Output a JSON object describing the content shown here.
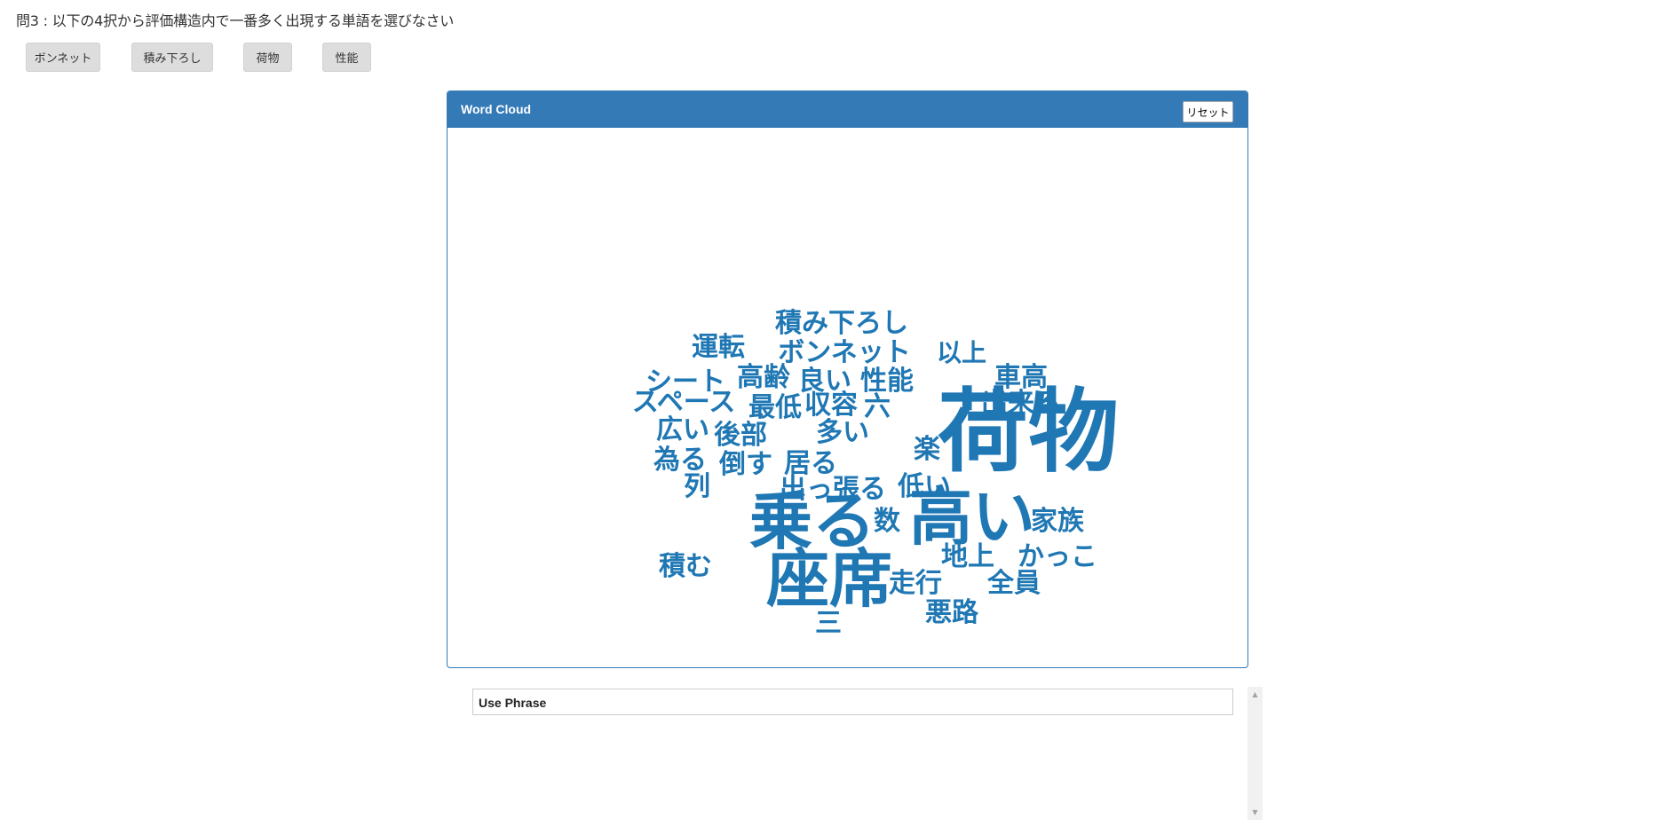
{
  "question": {
    "text": "問3 : 以下の4択から評価構造内で一番多く出現する単語を選びなさい"
  },
  "choices": [
    {
      "label": "ボンネット"
    },
    {
      "label": "積み下ろし"
    },
    {
      "label": "荷物"
    },
    {
      "label": "性能"
    }
  ],
  "panel": {
    "title": "Word Cloud",
    "reset_label": "リセット"
  },
  "word_cloud": {
    "color": "#1f77b4",
    "words": [
      {
        "text": "荷物"
      },
      {
        "text": "高い"
      },
      {
        "text": "乗る"
      },
      {
        "text": "座席"
      },
      {
        "text": "積み下ろし"
      },
      {
        "text": "運転"
      },
      {
        "text": "ボンネット"
      },
      {
        "text": "以上"
      },
      {
        "text": "シート"
      },
      {
        "text": "高齢"
      },
      {
        "text": "良い"
      },
      {
        "text": "性能"
      },
      {
        "text": "車高"
      },
      {
        "text": "スペース"
      },
      {
        "text": "最低"
      },
      {
        "text": "収容"
      },
      {
        "text": "六"
      },
      {
        "text": "出来る"
      },
      {
        "text": "広い"
      },
      {
        "text": "後部"
      },
      {
        "text": "多い"
      },
      {
        "text": "楽"
      },
      {
        "text": "為る"
      },
      {
        "text": "倒す"
      },
      {
        "text": "居る"
      },
      {
        "text": "列"
      },
      {
        "text": "出っ張る"
      },
      {
        "text": "低い"
      },
      {
        "text": "数"
      },
      {
        "text": "家族"
      },
      {
        "text": "地上"
      },
      {
        "text": "かっこ"
      },
      {
        "text": "積む"
      },
      {
        "text": "走行"
      },
      {
        "text": "全員"
      },
      {
        "text": "悪路"
      },
      {
        "text": "三"
      }
    ]
  },
  "phrase": {
    "label": "Use Phrase"
  },
  "scrollbar": {
    "up_glyph": "▲",
    "down_glyph": "▼"
  }
}
